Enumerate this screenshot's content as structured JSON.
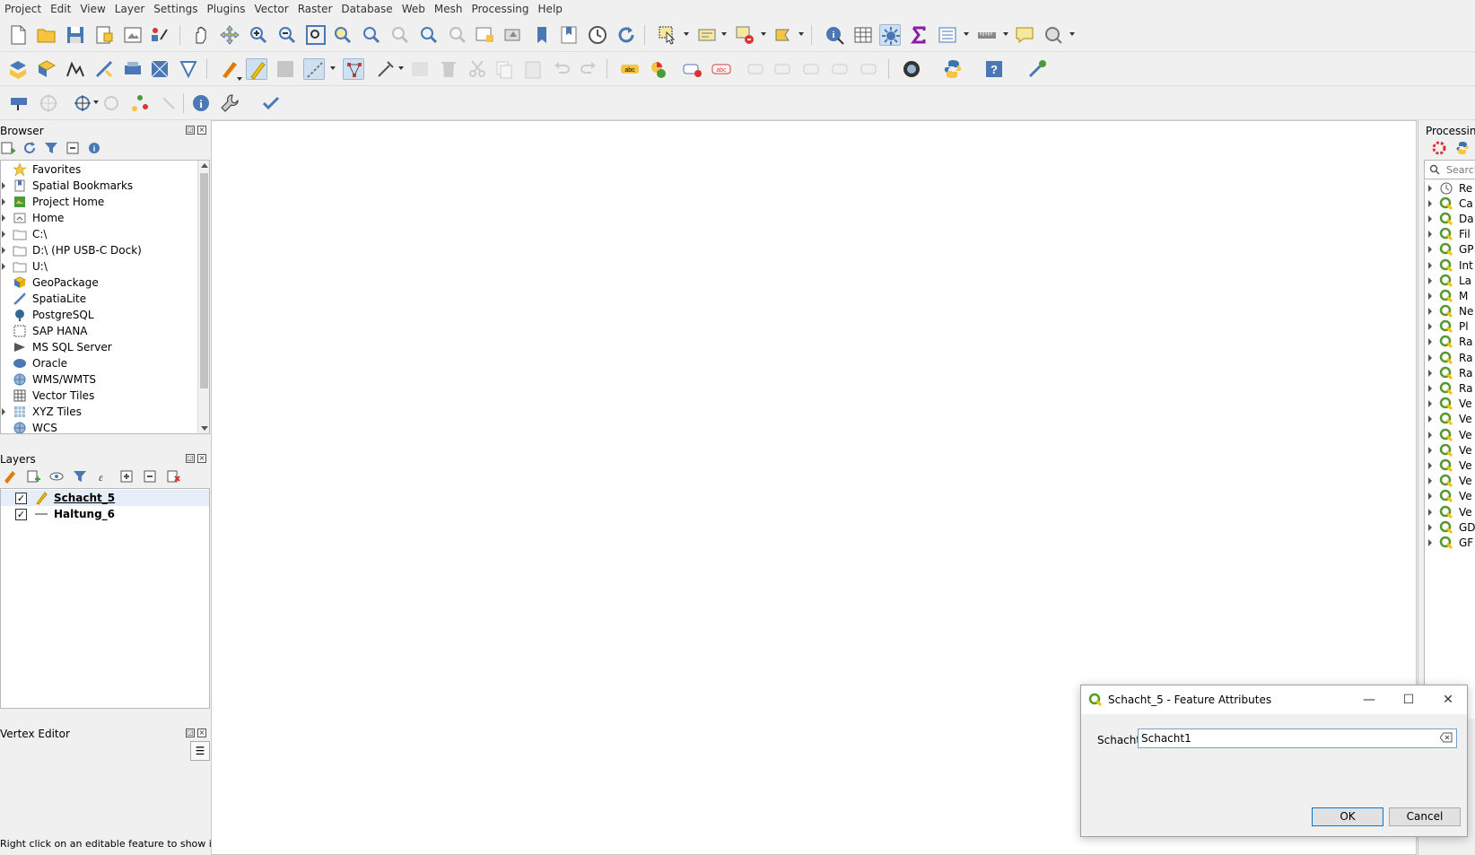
{
  "menu": [
    "Project",
    "Edit",
    "View",
    "Layer",
    "Settings",
    "Plugins",
    "Vector",
    "Raster",
    "Database",
    "Web",
    "Mesh",
    "Processing",
    "Help"
  ],
  "browser": {
    "title": "Browser",
    "items": [
      {
        "label": "Favorites",
        "icon": "star-icon",
        "arrow": false
      },
      {
        "label": "Spatial Bookmarks",
        "icon": "bookmark-icon",
        "arrow": true
      },
      {
        "label": "Project Home",
        "icon": "project-home-icon",
        "arrow": true
      },
      {
        "label": "Home",
        "icon": "home-icon",
        "arrow": true
      },
      {
        "label": "C:\\",
        "icon": "folder-icon",
        "arrow": true
      },
      {
        "label": "D:\\ (HP USB-C Dock)",
        "icon": "folder-icon",
        "arrow": true
      },
      {
        "label": "U:\\",
        "icon": "folder-icon",
        "arrow": true
      },
      {
        "label": "GeoPackage",
        "icon": "geopackage-icon",
        "arrow": false
      },
      {
        "label": "SpatiaLite",
        "icon": "spatialite-icon",
        "arrow": false
      },
      {
        "label": "PostgreSQL",
        "icon": "postgresql-icon",
        "arrow": false
      },
      {
        "label": "SAP HANA",
        "icon": "sap-hana-icon",
        "arrow": false
      },
      {
        "label": "MS SQL Server",
        "icon": "mssql-icon",
        "arrow": false
      },
      {
        "label": "Oracle",
        "icon": "oracle-icon",
        "arrow": false
      },
      {
        "label": "WMS/WMTS",
        "icon": "wms-icon",
        "arrow": false
      },
      {
        "label": "Vector Tiles",
        "icon": "vector-tiles-icon",
        "arrow": false
      },
      {
        "label": "XYZ Tiles",
        "icon": "xyz-tiles-icon",
        "arrow": true
      },
      {
        "label": "WCS",
        "icon": "wcs-icon",
        "arrow": false
      }
    ]
  },
  "layers": {
    "title": "Layers",
    "items": [
      {
        "label": "Schacht_5",
        "checked": true,
        "editing": true
      },
      {
        "label": "Haltung_6",
        "checked": true,
        "editing": false
      }
    ]
  },
  "vertex_editor": {
    "title": "Vertex Editor",
    "hint": "Right click on an editable feature to show its"
  },
  "processing": {
    "title": "Processing",
    "search_placeholder": "Search",
    "items": [
      "Re",
      "Ca",
      "Da",
      "Fil",
      "GP",
      "Int",
      "La",
      "M",
      "Ne",
      "Pl",
      "Ra",
      "Ra",
      "Ra",
      "Ra",
      "Ve",
      "Ve",
      "Ve",
      "Ve",
      "Ve",
      "Ve",
      "Ve",
      "Ve",
      "GD",
      "GF"
    ]
  },
  "dialog": {
    "title": "Schacht_5 - Feature Attributes",
    "field_label": "Schacht",
    "field_value": "Schacht1",
    "ok": "OK",
    "cancel": "Cancel"
  },
  "colors": {
    "qgis_green": "#589632",
    "accent_blue": "#0078d7",
    "editing_yellow": "#f2c200"
  }
}
